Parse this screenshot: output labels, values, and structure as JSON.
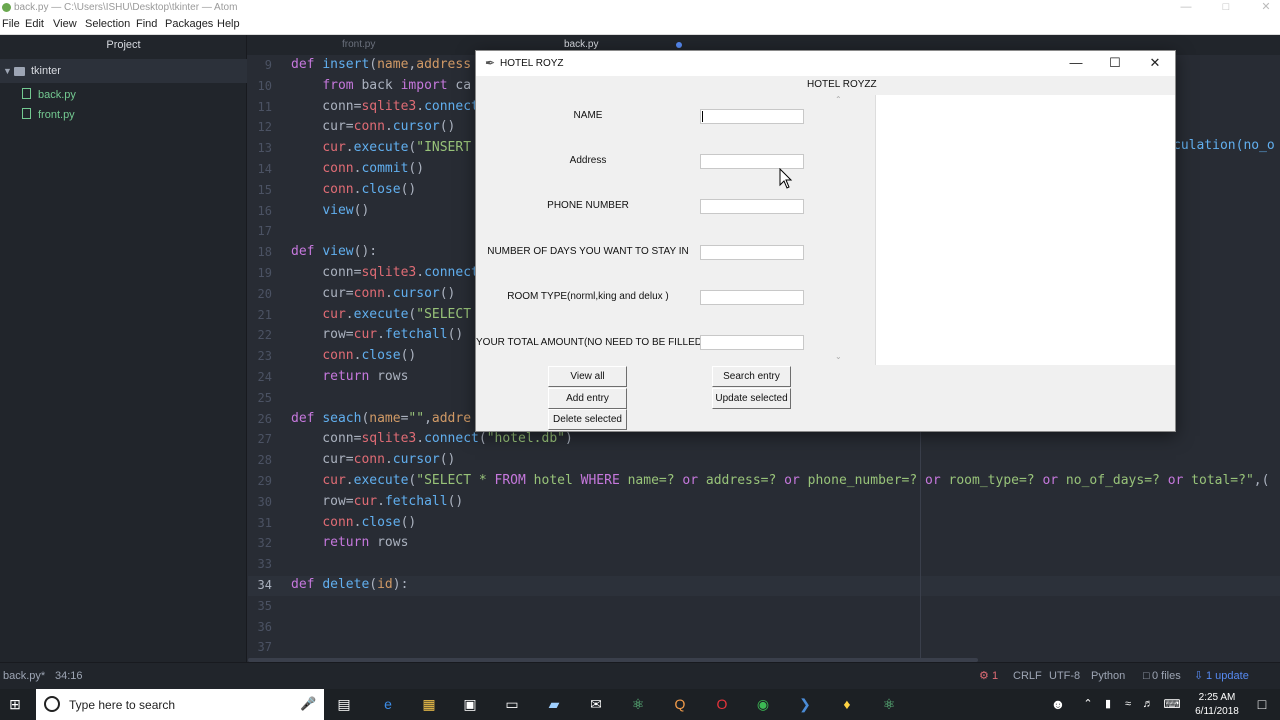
{
  "atom": {
    "title": "back.py — C:\\Users\\ISHU\\Desktop\\tkinter — Atom",
    "menu": [
      "File",
      "Edit",
      "View",
      "Selection",
      "Find",
      "Packages",
      "Help"
    ],
    "sidebar": {
      "header": "Project",
      "folder": "tkinter",
      "files": [
        "back.py",
        "front.py"
      ]
    },
    "tabs": [
      {
        "label": "front.py"
      },
      {
        "label": "back.py"
      }
    ],
    "status": {
      "file": "back.py*",
      "cursor": "34:16",
      "issues": "1",
      "line_ending": "CRLF",
      "encoding": "UTF-8",
      "grammar": "Python",
      "git": "0 files",
      "update": "1 update"
    }
  },
  "code_lines": [
    {
      "n": "9",
      "html": "<span class='kw'>def</span> <span class='fn'>insert</span>(<span class='pa'>name</span>,<span class='pa'>address</span>"
    },
    {
      "n": "10",
      "html": "    <span class='kw'>from</span> back <span class='kw'>import</span> ca"
    },
    {
      "n": "11",
      "html": "    conn=<span class='vr'>sqlite3</span>.<span class='fn'>connect</span>"
    },
    {
      "n": "12",
      "html": "    cur=<span class='vr'>conn</span>.<span class='fn'>cursor</span>()"
    },
    {
      "n": "13",
      "html": "    <span class='vr'>cur</span>.<span class='fn'>execute</span>(<span class='st'>\"INSERT</span>"
    },
    {
      "n": "14",
      "html": "    <span class='vr'>conn</span>.<span class='fn'>commit</span>()"
    },
    {
      "n": "15",
      "html": "    <span class='vr'>conn</span>.<span class='fn'>close</span>()"
    },
    {
      "n": "16",
      "html": "    <span class='fn'>view</span>()"
    },
    {
      "n": "17",
      "html": ""
    },
    {
      "n": "18",
      "html": "<span class='kw'>def</span> <span class='fn'>view</span>():"
    },
    {
      "n": "19",
      "html": "    conn=<span class='vr'>sqlite3</span>.<span class='fn'>connect</span>"
    },
    {
      "n": "20",
      "html": "    cur=<span class='vr'>conn</span>.<span class='fn'>cursor</span>()"
    },
    {
      "n": "21",
      "html": "    <span class='vr'>cur</span>.<span class='fn'>execute</span>(<span class='st'>\"SELECT</span>"
    },
    {
      "n": "22",
      "html": "    row=<span class='vr'>cur</span>.<span class='fn'>fetchall</span>()"
    },
    {
      "n": "23",
      "html": "    <span class='vr'>conn</span>.<span class='fn'>close</span>()"
    },
    {
      "n": "24",
      "html": "    <span class='kw'>return</span> rows"
    },
    {
      "n": "25",
      "html": ""
    },
    {
      "n": "26",
      "html": "<span class='kw'>def</span> <span class='fn'>seach</span>(<span class='pa'>name</span>=<span class='st'>\"\"</span>,<span class='pa'>addre</span>"
    },
    {
      "n": "27",
      "html": "    conn=<span class='vr'>sqlite3</span>.<span class='fn'>connect</span>(<span class='st'>\"hotel.db\"</span>)"
    },
    {
      "n": "28",
      "html": "    cur=<span class='vr'>conn</span>.<span class='fn'>cursor</span>()"
    },
    {
      "n": "29",
      "html": "    <span class='vr'>cur</span>.<span class='fn'>execute</span>(<span class='st'>\"SELECT * <span class='kw'>FROM</span> hotel <span class='kw'>WHERE</span> name=? <span class='kw'>or</span> address=? <span class='kw'>or</span> phone_number=? <span class='kw'>or</span> room_type=? <span class='kw'>or</span> no_of_days=? <span class='kw'>or</span> total=?\"</span>,("
    },
    {
      "n": "30",
      "html": "    row=<span class='vr'>cur</span>.<span class='fn'>fetchall</span>()"
    },
    {
      "n": "31",
      "html": "    <span class='vr'>conn</span>.<span class='fn'>close</span>()"
    },
    {
      "n": "32",
      "html": "    <span class='kw'>return</span> rows"
    },
    {
      "n": "33",
      "html": ""
    },
    {
      "n": "34",
      "html": "<span class='kw'>def</span> <span class='fn'>delete</span>(<span class='pa'>id</span>):"
    },
    {
      "n": "35",
      "html": ""
    },
    {
      "n": "36",
      "html": ""
    },
    {
      "n": "37",
      "html": ""
    }
  ],
  "code_overflow_right": "culation(no_o",
  "tk": {
    "title": "HOTEL ROYZ",
    "heading": "HOTEL ROYZZ",
    "fields": [
      {
        "label": "NAME",
        "value": ""
      },
      {
        "label": "Address",
        "value": ""
      },
      {
        "label": "PHONE NUMBER",
        "value": ""
      },
      {
        "label": "NUMBER OF DAYS YOU WANT TO STAY IN",
        "value": ""
      },
      {
        "label": "ROOM TYPE(norml,king and delux )",
        "value": ""
      },
      {
        "label": "YOUR TOTAL AMOUNT(NO NEED TO BE FILLED)",
        "value": ""
      }
    ],
    "buttons": {
      "view_all": "View all",
      "search": "Search entry",
      "add": "Add entry",
      "update": "Update selected",
      "delete": "Delete selected"
    }
  },
  "taskbar": {
    "search_placeholder": "Type here to search",
    "time": "2:25 AM",
    "date": "6/11/2018"
  },
  "colors": {
    "editor_bg": "#282c34",
    "keyword": "#c678dd",
    "function": "#61afef",
    "string": "#98c379",
    "variable": "#e06c75"
  }
}
